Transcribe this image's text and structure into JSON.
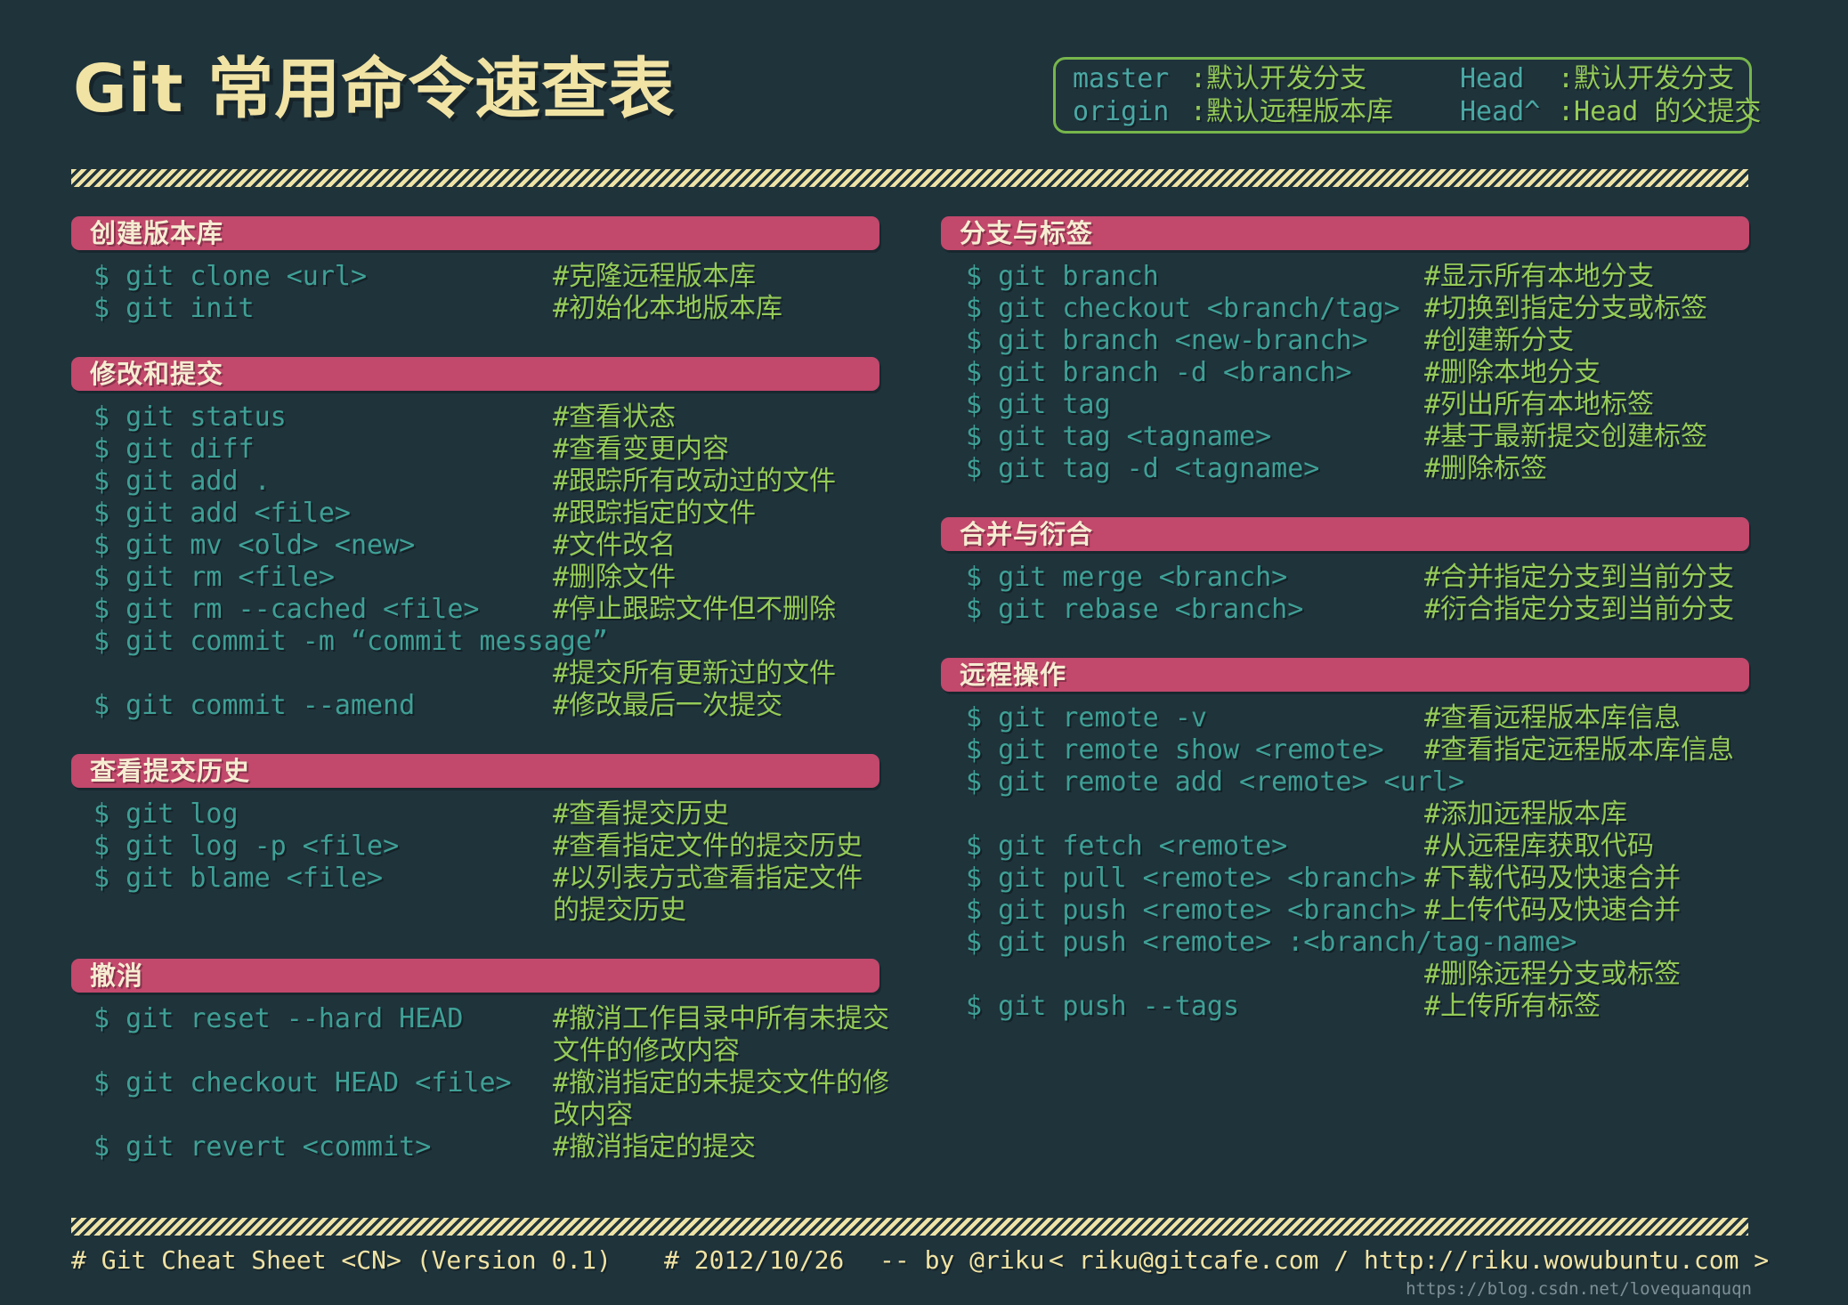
{
  "title": "Git 常用命令速查表",
  "colors": {
    "background": "#1f333b",
    "title_text": "#f0e3a4",
    "section_header_bg": "#c2486c",
    "section_header_text": "#f6ecd2",
    "command": "#3fa096",
    "comment": "#95cb58",
    "legend_term": "#4aa8a4",
    "legend_border": "#77b64b",
    "divider": "#efe3a6",
    "watermark": "#8fa0a6"
  },
  "legend": {
    "entries": [
      {
        "term": "master",
        "desc": ":默认开发分支"
      },
      {
        "term": "Head",
        "desc": ":默认开发分支"
      },
      {
        "term": "origin",
        "desc": ":默认远程版本库"
      },
      {
        "term": "Head^",
        "desc": ":Head 的父提交"
      }
    ]
  },
  "sections": {
    "left": [
      {
        "header": "创建版本库",
        "rows": [
          {
            "cmd": "$ git clone <url>",
            "note": "#克隆远程版本库"
          },
          {
            "cmd": "$ git init",
            "note": "#初始化本地版本库"
          }
        ]
      },
      {
        "header": "修改和提交",
        "rows": [
          {
            "cmd": "$ git status",
            "note": "#查看状态"
          },
          {
            "cmd": "$ git diff",
            "note": "#查看变更内容"
          },
          {
            "cmd": "$ git add .",
            "note": "#跟踪所有改动过的文件"
          },
          {
            "cmd": "$ git add <file>",
            "note": "#跟踪指定的文件"
          },
          {
            "cmd": "$ git mv <old> <new>",
            "note": "#文件改名"
          },
          {
            "cmd": "$ git rm <file>",
            "note": "#删除文件"
          },
          {
            "cmd": "$ git rm --cached <file>",
            "note": "#停止跟踪文件但不删除"
          },
          {
            "cmd": "$ git commit -m “commit message”",
            "note": ""
          },
          {
            "cmd": "",
            "note": "#提交所有更新过的文件"
          },
          {
            "cmd": "$ git commit --amend",
            "note": "#修改最后一次提交"
          }
        ]
      },
      {
        "header": "查看提交历史",
        "rows": [
          {
            "cmd": "$ git log",
            "note": "#查看提交历史"
          },
          {
            "cmd": "$ git log -p <file>",
            "note": "#查看指定文件的提交历史"
          },
          {
            "cmd": "$ git blame <file>",
            "note": "#以列表方式查看指定文件"
          },
          {
            "cmd": "",
            "note": "的提交历史"
          }
        ]
      },
      {
        "header": "撤消",
        "rows": [
          {
            "cmd": "$ git reset --hard HEAD",
            "note": "#撤消工作目录中所有未提交"
          },
          {
            "cmd": "",
            "note": "文件的修改内容"
          },
          {
            "cmd": "$ git checkout HEAD <file>",
            "note": "#撤消指定的未提交文件的修"
          },
          {
            "cmd": "",
            "note": "改内容"
          },
          {
            "cmd": "$ git revert <commit>",
            "note": "#撤消指定的提交"
          }
        ]
      }
    ],
    "right": [
      {
        "header": "分支与标签",
        "rows": [
          {
            "cmd": "$ git branch",
            "note": "#显示所有本地分支"
          },
          {
            "cmd": "$ git checkout <branch/tag>",
            "note": "#切换到指定分支或标签"
          },
          {
            "cmd": "$ git branch <new-branch>",
            "note": "#创建新分支"
          },
          {
            "cmd": "$ git branch -d <branch>",
            "note": "#删除本地分支"
          },
          {
            "cmd": "$ git tag",
            "note": "#列出所有本地标签"
          },
          {
            "cmd": "$ git tag <tagname>",
            "note": "#基于最新提交创建标签"
          },
          {
            "cmd": "$ git tag -d <tagname>",
            "note": "#删除标签"
          }
        ]
      },
      {
        "header": "合并与衍合",
        "rows": [
          {
            "cmd": "$ git merge <branch>",
            "note": "#合并指定分支到当前分支"
          },
          {
            "cmd": "$ git rebase <branch>",
            "note": "#衍合指定分支到当前分支"
          }
        ]
      },
      {
        "header": "远程操作",
        "rows": [
          {
            "cmd": "$ git remote -v",
            "note": "#查看远程版本库信息"
          },
          {
            "cmd": "$ git remote show <remote>",
            "note": "#查看指定远程版本库信息"
          },
          {
            "cmd": "$ git remote add <remote> <url>",
            "note": ""
          },
          {
            "cmd": "",
            "note": "#添加远程版本库"
          },
          {
            "cmd": "$ git fetch <remote>",
            "note": "#从远程库获取代码"
          },
          {
            "cmd": "$ git pull <remote> <branch>",
            "note": "#下载代码及快速合并"
          },
          {
            "cmd": "$ git push <remote> <branch>",
            "note": "#上传代码及快速合并"
          },
          {
            "cmd": "$ git push <remote> :<branch/tag-name>",
            "note": ""
          },
          {
            "cmd": "",
            "note": "#删除远程分支或标签"
          },
          {
            "cmd": "$ git push --tags",
            "note": "#上传所有标签"
          }
        ]
      }
    ]
  },
  "footer": {
    "sheet_label": "# Git Cheat Sheet <CN> (Version 0.1)",
    "date_label": "# 2012/10/26",
    "author_label": "-- by @riku",
    "contact_label": "< riku@gitcafe.com / http://riku.wowubuntu.com >",
    "watermark": "https://blog.csdn.net/lovequanquqn"
  }
}
